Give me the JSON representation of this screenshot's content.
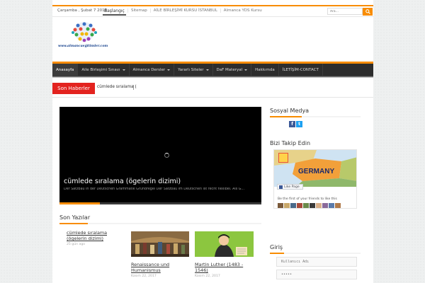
{
  "topbar": {
    "date": "Çarşamba , Şubat 7 2018",
    "start_link": "Başlangıç",
    "links": [
      "Sitemap",
      "AİLE BİRLEŞİMİ KURSU İSTANBUL",
      "Almanca YDS Kursu"
    ],
    "search_placeholder": "Ara..."
  },
  "logo": {
    "url_text": "www.almancaeğitimler.com"
  },
  "nav": {
    "items": [
      {
        "label": "Anasayfa",
        "dropdown": false
      },
      {
        "label": "Aile Birleşimi Sınavı",
        "dropdown": true
      },
      {
        "label": "Almanca Dersler",
        "dropdown": true
      },
      {
        "label": "Yararlı Siteler",
        "dropdown": true
      },
      {
        "label": "DaF Materyal",
        "dropdown": true
      },
      {
        "label": "Hakkımda",
        "dropdown": false
      },
      {
        "label": "İLETİŞİM-CONTACT",
        "dropdown": false
      }
    ]
  },
  "ticker": {
    "label": "Son Haberler",
    "text": "cümlede sıralama ("
  },
  "slider": {
    "title": "cümlede sıralama (ögelerin dizimi)",
    "excerpt": "Der Satzbau in der Deutschen Grammatik Grundregel Der Satzbau im Deutschen ist recht flexibel. Als G...",
    "progress": 0.2
  },
  "recent": {
    "title": "Son Yazılar",
    "posts": [
      {
        "title_line1": "cümlede sıralama",
        "title_line2": "(ögelerin dizimi)",
        "date": "25 gün ago"
      },
      {
        "title_line1": "Renaissance und",
        "title_line2": "Humanismus",
        "date": "Kasım 22, 2017"
      },
      {
        "title_line1": "Martin Luther (1483 -",
        "title_line2": "1546)",
        "date": "Kasım 22, 2017"
      }
    ]
  },
  "sidebar": {
    "social_title": "Sosyal Medya",
    "follow_title": "Bizi Takip Edin",
    "fb_like": "Like Page",
    "fb_first": "Be the first of your friends to like this",
    "map_label": "GERMANY",
    "login_title": "Giriş",
    "username_value": "Kullanıcı Adı",
    "password_value": "•••••"
  },
  "colors": {
    "accent": "#f88c00",
    "news_red": "#e3231f",
    "nav_bg": "#2d2d2d",
    "facebook": "#3b5998",
    "twitter": "#1da1f2"
  }
}
